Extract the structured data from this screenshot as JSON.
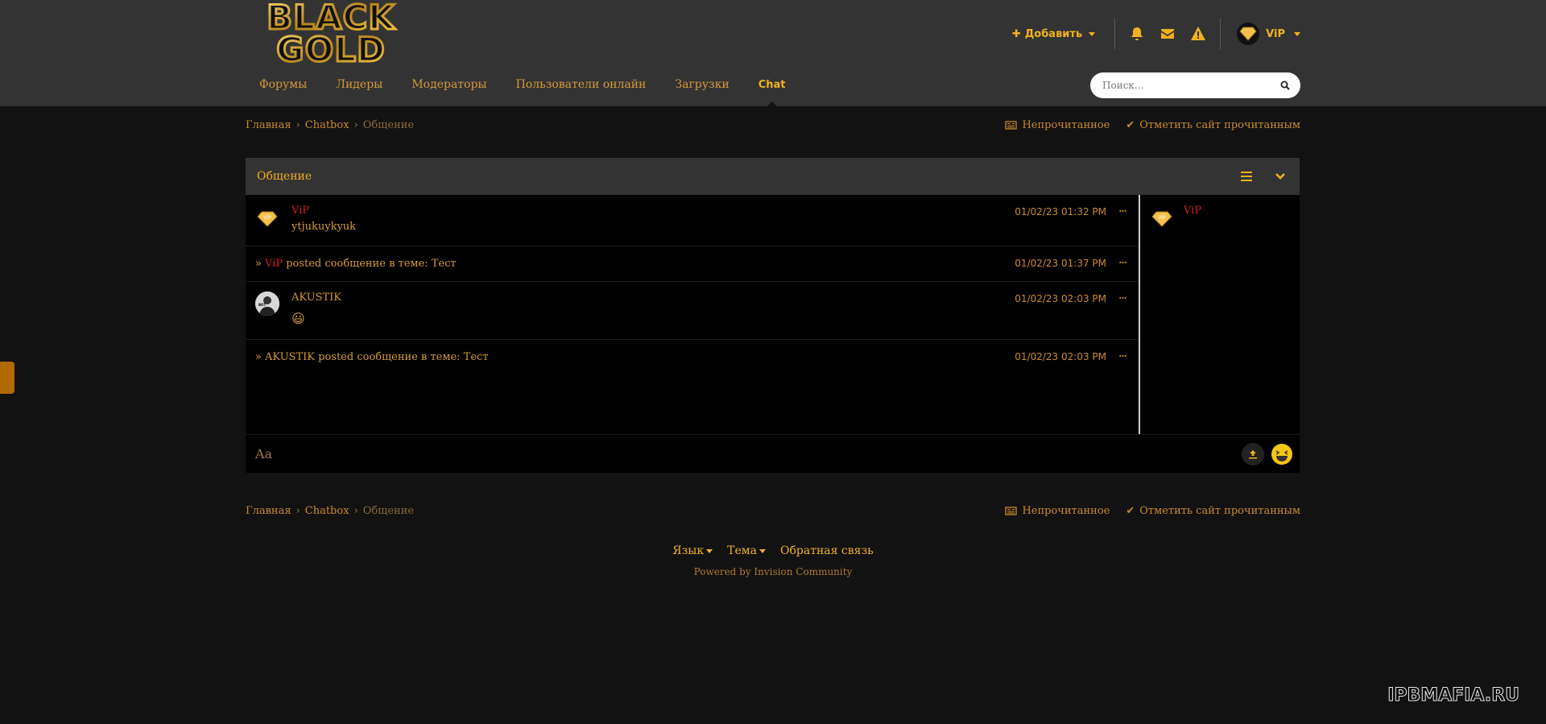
{
  "header": {
    "logo_text": "BLACK GOLD",
    "add_label": "Добавить",
    "username": "ViP",
    "search": {
      "placeholder": "Поиск..."
    }
  },
  "nav": {
    "items": [
      {
        "label": "Форумы"
      },
      {
        "label": "Лидеры"
      },
      {
        "label": "Модераторы"
      },
      {
        "label": "Пользователи онлайн"
      },
      {
        "label": "Загрузки"
      },
      {
        "label": "Chat"
      }
    ]
  },
  "breadcrumb": {
    "home": "Главная",
    "chatbox": "Chatbox",
    "current": "Общение",
    "unread": "Непрочитанное",
    "mark_read": "Отметить сайт прочитанным"
  },
  "chat": {
    "title": "Общение",
    "messages": [
      {
        "user": "ViP",
        "text": "ytjukuykyuk",
        "time": "01/02/23 01:32 PM"
      },
      {
        "user": "ViP",
        "action": "posted сообщение в теме: Тест",
        "time": "01/02/23 01:37 PM"
      },
      {
        "user": "AKUSTIK",
        "text": "😃",
        "time": "01/02/23 02:03 PM"
      },
      {
        "user": "AKUSTIK",
        "action": "posted сообщение в теме: Тест",
        "time": "01/02/23 02:03 PM"
      }
    ],
    "online_users": [
      {
        "name": "ViP"
      }
    ],
    "input_placeholder": "Aa"
  },
  "footer": {
    "language": "Язык",
    "theme": "Тема",
    "feedback": "Обратная связь",
    "powered": "Powered by Invision Community"
  },
  "watermark": "IPBMAFIA.RU",
  "colors": {
    "accent": "#f0b020",
    "header_bg": "#333333",
    "page_bg": "#121212",
    "user_red": "#d11f1f"
  }
}
